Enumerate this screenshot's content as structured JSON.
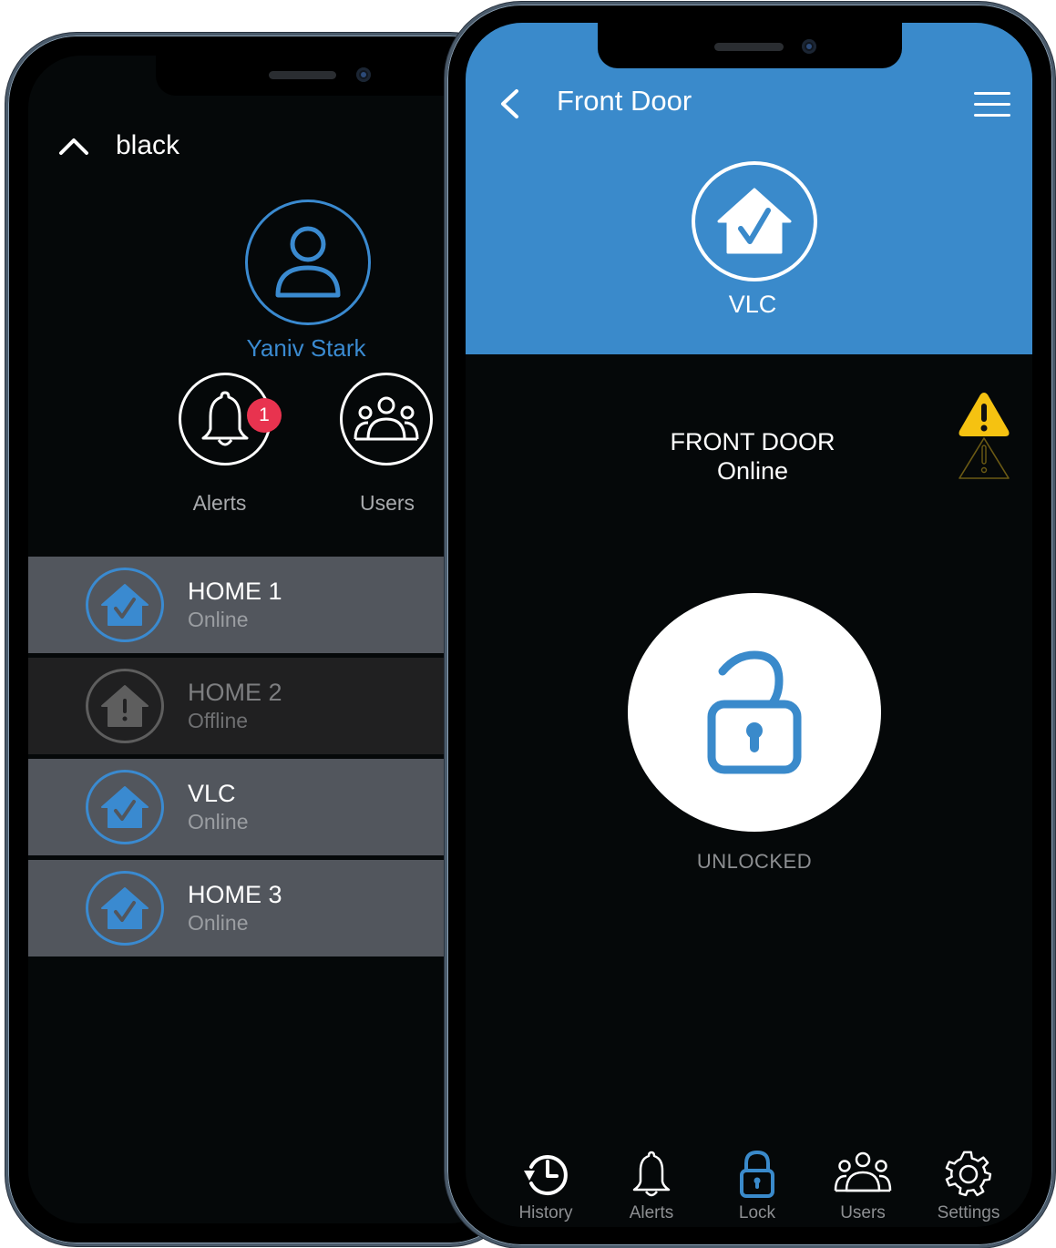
{
  "colors": {
    "accent": "#3a8acb",
    "badge": "#e8334f",
    "warning": "#f5c211",
    "row_online": "#52565d",
    "row_offline": "#202021"
  },
  "left_phone": {
    "header": {
      "title": "black",
      "collapse_icon": "chevron-up-icon"
    },
    "profile": {
      "name": "Yaniv Stark",
      "avatar_icon": "user-icon"
    },
    "quick_actions": [
      {
        "label": "Alerts",
        "icon": "bell-icon",
        "badge_count": "1"
      },
      {
        "label": "Users",
        "icon": "users-icon"
      }
    ],
    "homes": [
      {
        "name": "HOME 1",
        "status": "Online",
        "icon": "home-check-icon"
      },
      {
        "name": "HOME 2",
        "status": "Offline",
        "icon": "home-alert-icon"
      },
      {
        "name": "VLC",
        "status": "Online",
        "icon": "home-check-icon"
      },
      {
        "name": "HOME 3",
        "status": "Online",
        "icon": "home-check-icon"
      }
    ]
  },
  "right_phone": {
    "header": {
      "title": "Front Door",
      "back_icon": "chevron-left-icon",
      "menu_icon": "hamburger-menu-icon"
    },
    "device": {
      "location_name": "VLC",
      "icon": "home-check-icon"
    },
    "door": {
      "name": "FRONT DOOR",
      "status": "Online",
      "warning_icon": "warning-triangle-icon"
    },
    "lock": {
      "state": "UNLOCKED",
      "icon": "lock-open-icon"
    },
    "tabs": [
      {
        "label": "History",
        "icon": "history-icon",
        "active": false
      },
      {
        "label": "Alerts",
        "icon": "bell-icon",
        "active": false
      },
      {
        "label": "Lock",
        "icon": "lock-icon",
        "active": true
      },
      {
        "label": "Users",
        "icon": "users-icon",
        "active": false
      },
      {
        "label": "Settings",
        "icon": "gear-icon",
        "active": false
      }
    ]
  }
}
